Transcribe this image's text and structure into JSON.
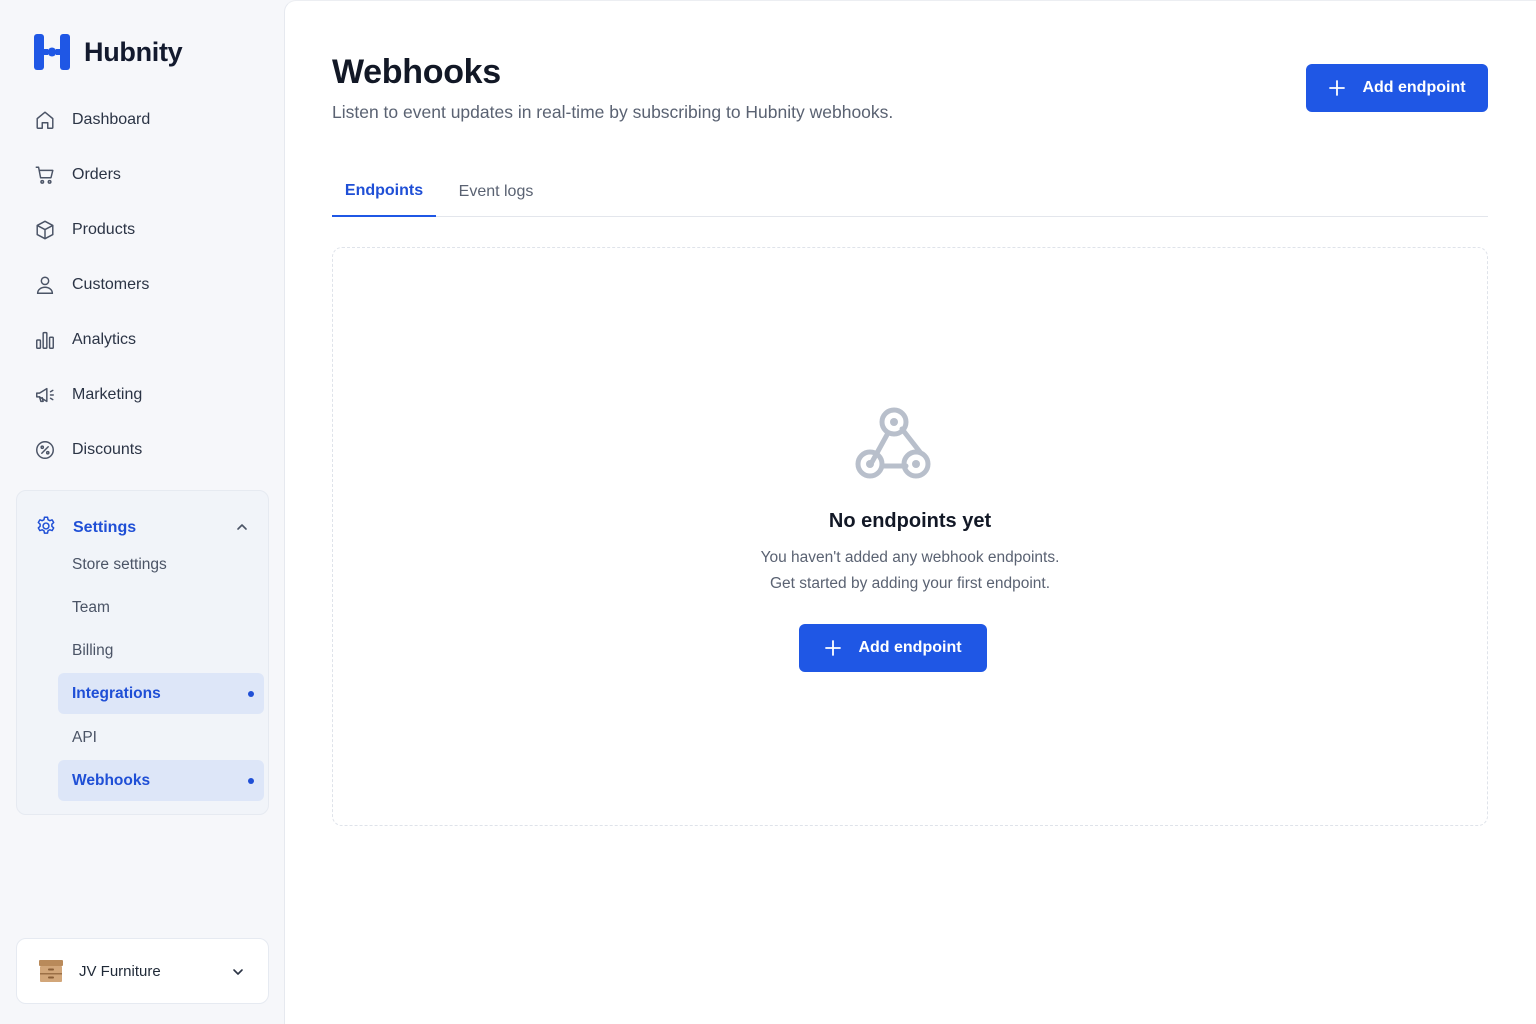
{
  "brand": {
    "name": "Hubnity",
    "color": "#1f57e5"
  },
  "nav": {
    "items": [
      {
        "label": "Dashboard",
        "icon": "home-icon"
      },
      {
        "label": "Orders",
        "icon": "cart-icon"
      },
      {
        "label": "Products",
        "icon": "box-icon"
      },
      {
        "label": "Customers",
        "icon": "user-icon"
      },
      {
        "label": "Analytics",
        "icon": "bar-chart-icon"
      },
      {
        "label": "Marketing",
        "icon": "megaphone-icon"
      },
      {
        "label": "Discounts",
        "icon": "discount-icon"
      }
    ],
    "settings": {
      "label": "Settings",
      "icon": "gear-icon",
      "expanded": true,
      "sub_items": [
        {
          "label": "Store settings"
        },
        {
          "label": "Team"
        },
        {
          "label": "Billing"
        },
        {
          "label": "Integrations"
        },
        {
          "label": "API"
        },
        {
          "label": "Webhooks"
        }
      ]
    }
  },
  "store": {
    "name": "JV Furniture"
  },
  "page": {
    "title": "Webhooks",
    "subtitle": "Listen to event updates in real-time by subscribing to Hubnity webhooks.",
    "add_button": "Add endpoint"
  },
  "tabs": [
    {
      "label": "Endpoints",
      "active": true
    },
    {
      "label": "Event logs",
      "active": false
    }
  ],
  "empty_state": {
    "icon": "webhook-icon",
    "title": "No endpoints yet",
    "line1": "You haven't added any webhook endpoints.",
    "line2": "Get started by adding your first endpoint.",
    "button": "Add endpoint"
  },
  "colors": {
    "accent": "#1f57e5",
    "active_text": "#1f4fd6",
    "active_bg": "#dde6f8"
  }
}
